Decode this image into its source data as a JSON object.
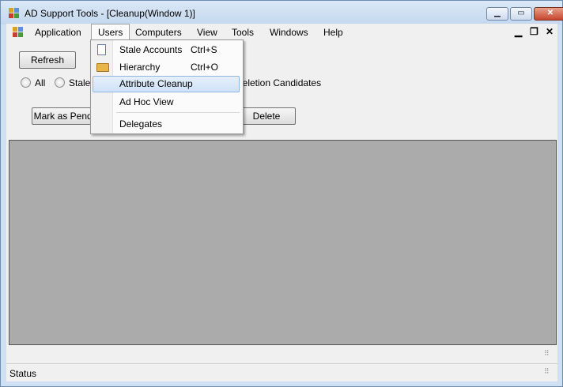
{
  "window": {
    "title": "AD Support Tools - [Cleanup(Window 1)]",
    "minimize_glyph": "▁",
    "maximize_glyph": "▭",
    "close_glyph": "✕"
  },
  "menubar": {
    "items": [
      "Application",
      "Users",
      "Computers",
      "View",
      "Tools",
      "Windows",
      "Help"
    ],
    "mdi_minimize": "▁",
    "mdi_restore": "❐",
    "mdi_close": "✕"
  },
  "toolbar": {
    "refresh_label": "Refresh",
    "radios": {
      "all": "All",
      "stale": "Stale",
      "deletion": "Deletion Candidates"
    },
    "mark_label": "Mark as Pendi",
    "delete_label": "Delete"
  },
  "users_menu": {
    "items": [
      {
        "label": "Stale Accounts",
        "shortcut": "Ctrl+S",
        "icon": "document-icon"
      },
      {
        "label": "Hierarchy",
        "shortcut": "Ctrl+O",
        "icon": "folder-open-icon"
      },
      {
        "label": "Attribute Cleanup",
        "shortcut": ""
      },
      {
        "label": "Ad Hoc View",
        "shortcut": ""
      },
      {
        "label": "Delegates",
        "shortcut": ""
      }
    ],
    "highlighted": "Attribute Cleanup"
  },
  "statusbar": {
    "text": "Status"
  },
  "colors": {
    "title_bar": "#c4d8ee",
    "grid_background": "#ababab",
    "highlight": "#cfe2f8"
  }
}
